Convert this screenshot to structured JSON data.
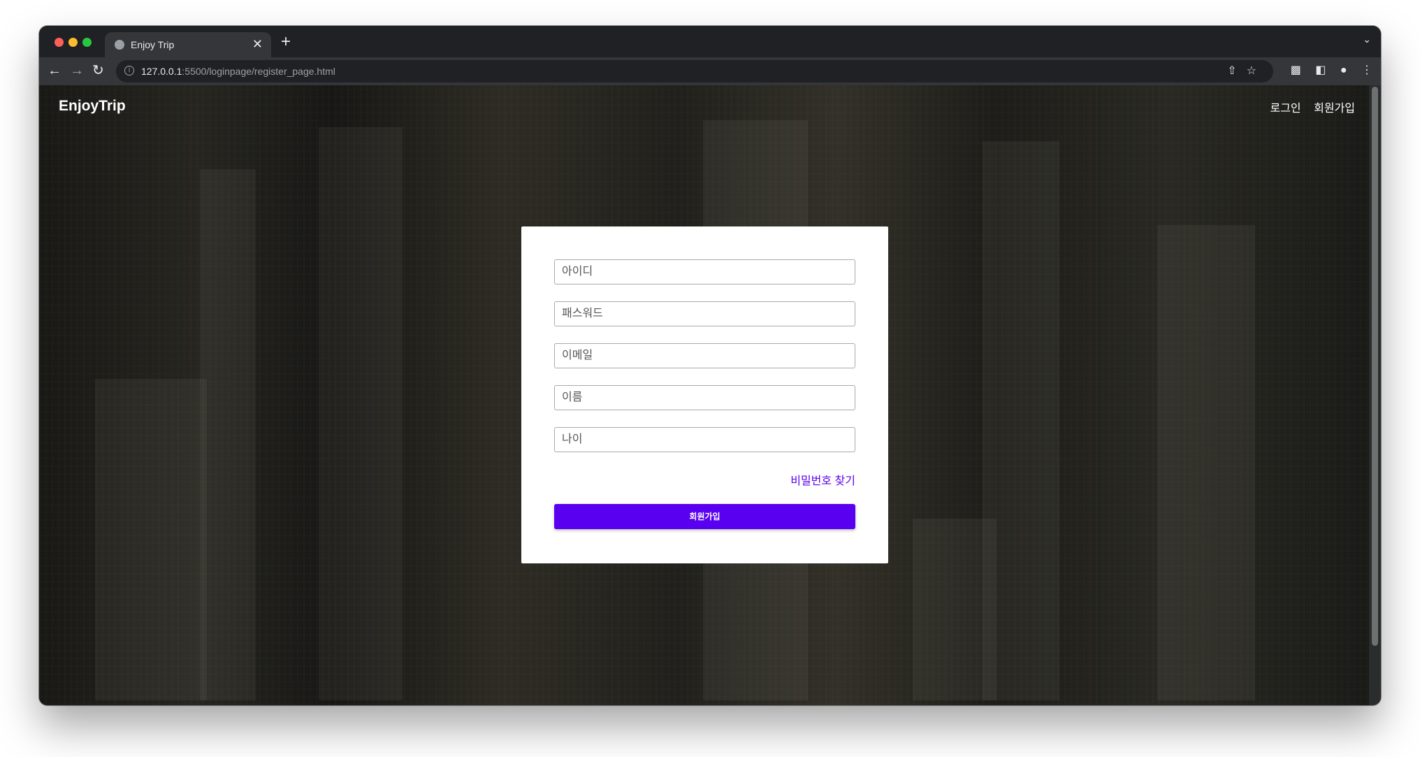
{
  "browser": {
    "tab_title": "Enjoy Trip",
    "tab_close": "✕",
    "new_tab": "+",
    "url_host": "127.0.0.1",
    "url_path": ":5500/loginpage/register_page.html",
    "icons": {
      "back": "arrow-left-icon",
      "forward": "arrow-right-icon",
      "reload": "reload-icon",
      "share": "share-icon",
      "bookmark": "star-icon",
      "extensions": "puzzle-icon",
      "sidepanel": "side-panel-icon",
      "profile": "profile-icon",
      "menu": "kebab-menu-icon"
    }
  },
  "site": {
    "logo": "EnjoyTrip",
    "nav": {
      "login": "로그인",
      "register": "회원가입"
    }
  },
  "form": {
    "fields": [
      {
        "placeholder": "아이디"
      },
      {
        "placeholder": "패스워드"
      },
      {
        "placeholder": "이메일"
      },
      {
        "placeholder": "이름"
      },
      {
        "placeholder": "나이"
      }
    ],
    "forgot_link": "비밀번호 찾기",
    "submit_label": "회원가입"
  },
  "colors": {
    "accent": "#5a00f0",
    "link": "#5a02ee"
  }
}
